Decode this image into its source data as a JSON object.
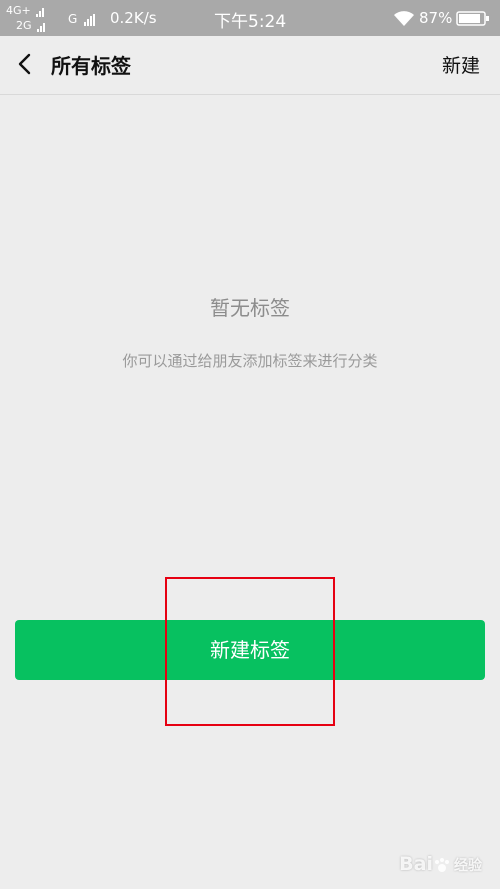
{
  "status_bar": {
    "network1": "4G+",
    "network2": "2G",
    "network3": "G",
    "speed": "0.2K/s",
    "time": "下午5:24",
    "battery": "87%"
  },
  "nav": {
    "title": "所有标签",
    "action": "新建"
  },
  "empty_state": {
    "title": "暂无标签",
    "description": "你可以通过给朋友添加标签来进行分类"
  },
  "primary_button": {
    "label": "新建标签"
  },
  "watermark": {
    "text": "Bai",
    "suffix": "经验"
  },
  "colors": {
    "accent": "#07c160",
    "background": "#ededed",
    "highlight": "#e60012"
  }
}
